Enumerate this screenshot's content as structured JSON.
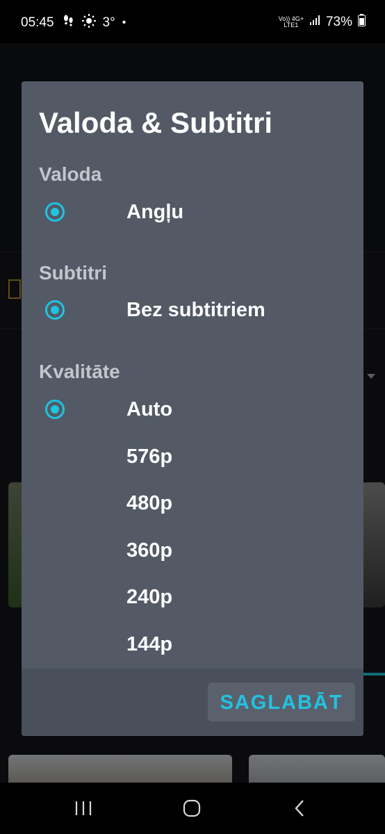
{
  "status_bar": {
    "time": "05:45",
    "temperature": "3°",
    "network_top": "Vo)) 4G+",
    "network_bottom": "LTE1",
    "battery": "73%"
  },
  "dialog": {
    "title": "Valoda & Subtitri",
    "language": {
      "label": "Valoda",
      "selected": "Angļu"
    },
    "subtitles": {
      "label": "Subtitri",
      "selected": "Bez subtitriem"
    },
    "quality": {
      "label": "Kvalitāte",
      "options": [
        "Auto",
        "576p",
        "480p",
        "360p",
        "240p",
        "144p"
      ],
      "selected_index": 0
    },
    "save_label": "SAGLABĀT"
  },
  "colors": {
    "accent": "#1ec4e0",
    "dialog_bg": "#535a66",
    "footer_bg": "#4a505b"
  },
  "icons": {
    "nav_recent": "recent-apps-icon",
    "nav_home": "home-icon",
    "nav_back": "back-icon"
  }
}
